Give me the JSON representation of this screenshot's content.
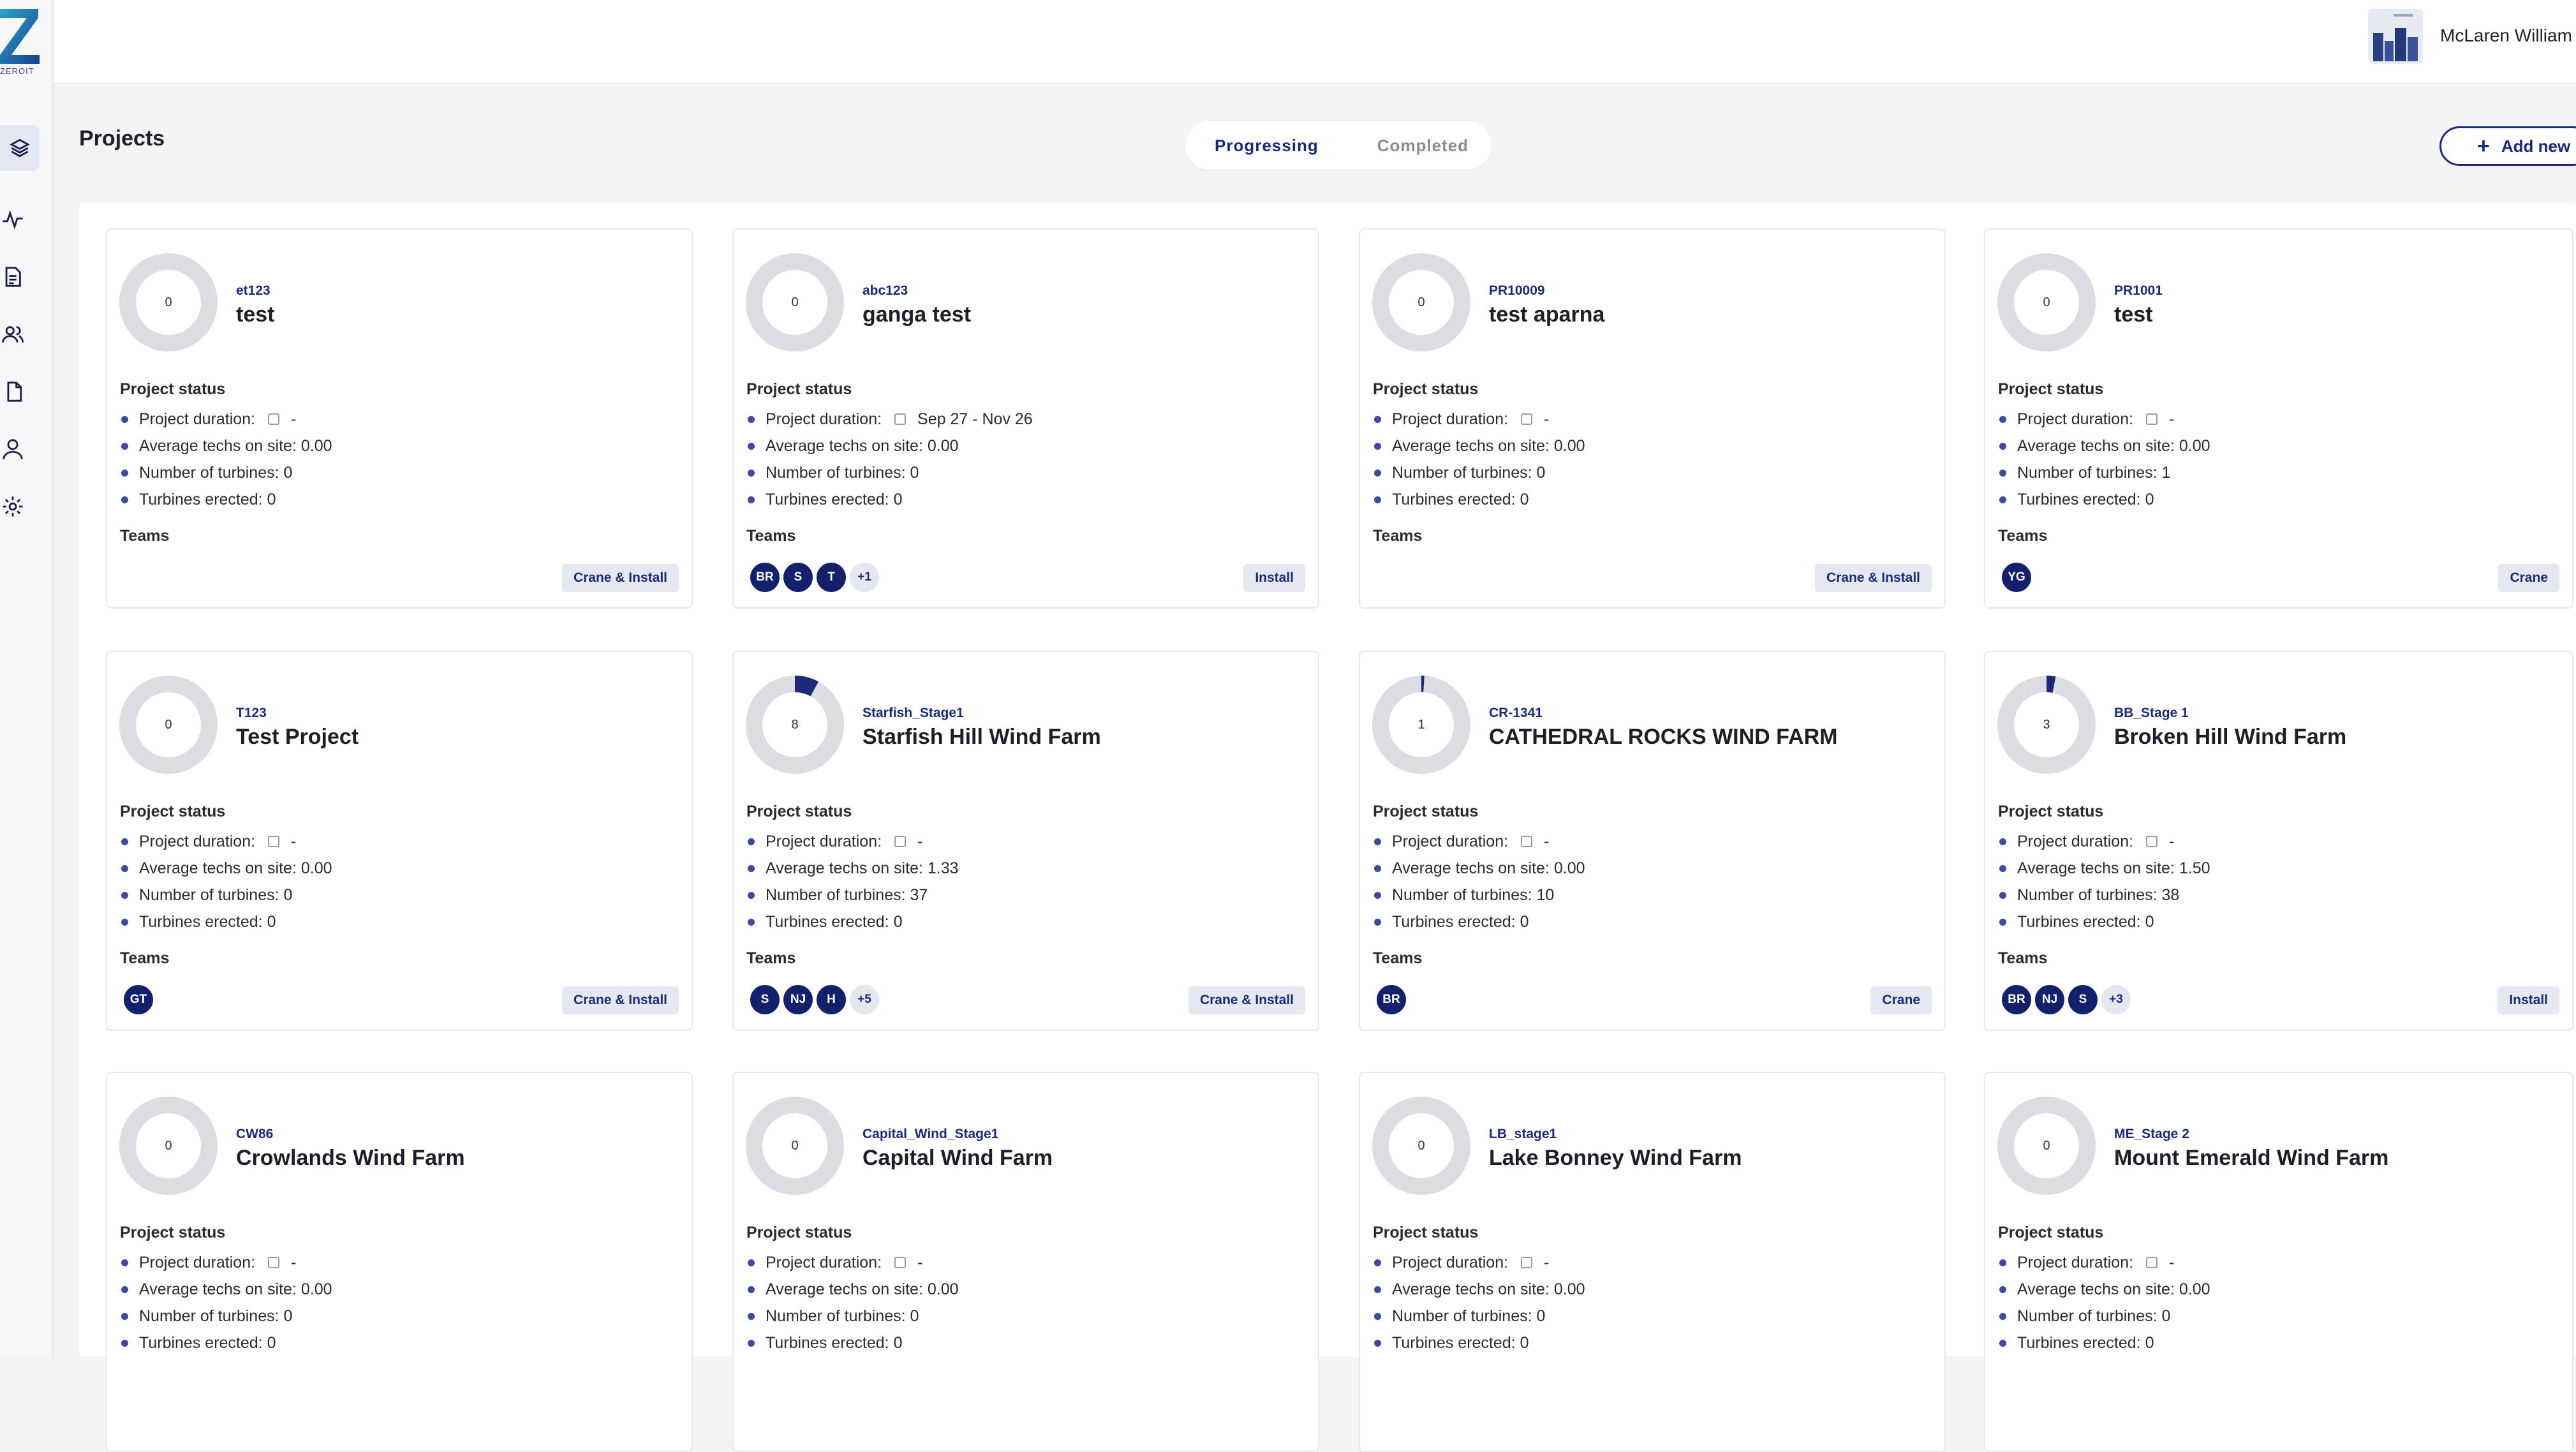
{
  "brand": {
    "logo_text": "ZEROIT"
  },
  "nav": {
    "items": [
      "projects-icon",
      "activity-icon",
      "documents-icon",
      "teams-icon",
      "files-icon",
      "profile-icon",
      "settings-icon"
    ]
  },
  "header": {
    "user_name": "McLaren William"
  },
  "page": {
    "title": "Projects",
    "tabs": [
      "Progressing",
      "Completed"
    ],
    "add_label": "Add new",
    "status_label": "Project status",
    "teams_label": "Teams",
    "duration_label": "Project duration:",
    "avg_label": "Average techs on site:",
    "turbines_label": "Number of turbines:",
    "erected_label": "Turbines erected:"
  },
  "projects": [
    {
      "code": "et123",
      "name": "test",
      "donut": "0",
      "duration": "-",
      "avg": "0.00",
      "turbines": "0",
      "erected": "0",
      "members": [],
      "tag": "Crane & Install"
    },
    {
      "code": "abc123",
      "name": "ganga test",
      "donut": "0",
      "duration": "Sep 27 - Nov 26",
      "avg": "0.00",
      "turbines": "0",
      "erected": "0",
      "members": [
        "BR",
        "S",
        "T",
        "+1"
      ],
      "tag": "Install"
    },
    {
      "code": "PR10009",
      "name": "test aparna",
      "donut": "0",
      "duration": "-",
      "avg": "0.00",
      "turbines": "0",
      "erected": "0",
      "members": [],
      "tag": "Crane & Install"
    },
    {
      "code": "PR1001",
      "name": "test",
      "donut": "0",
      "duration": "-",
      "avg": "0.00",
      "turbines": "1",
      "erected": "0",
      "members": [
        "YG"
      ],
      "tag": "Crane"
    },
    {
      "code": "T123",
      "name": "Test Project",
      "donut": "0",
      "duration": "-",
      "avg": "0.00",
      "turbines": "0",
      "erected": "0",
      "members": [
        "GT"
      ],
      "tag": "Crane & Install"
    },
    {
      "code": "Starfish_Stage1",
      "name": "Starfish Hill Wind Farm",
      "donut": "8",
      "duration": "-",
      "avg": "1.33",
      "turbines": "37",
      "erected": "0",
      "members": [
        "S",
        "NJ",
        "H",
        "+5"
      ],
      "tag": "Crane & Install"
    },
    {
      "code": "CR-1341",
      "name": "CATHEDRAL ROCKS WIND FARM",
      "donut": "1",
      "duration": "-",
      "avg": "0.00",
      "turbines": "10",
      "erected": "0",
      "members": [
        "BR"
      ],
      "tag": "Crane"
    },
    {
      "code": "BB_Stage 1",
      "name": "Broken Hill Wind Farm",
      "donut": "3",
      "duration": "-",
      "avg": "1.50",
      "turbines": "38",
      "erected": "0",
      "members": [
        "BR",
        "NJ",
        "S",
        "+3"
      ],
      "tag": "Install"
    },
    {
      "code": "CW86",
      "name": "Crowlands Wind Farm",
      "donut": "0",
      "duration": "-",
      "avg": "0.00",
      "turbines": "0",
      "erected": "0",
      "members": [],
      "tag": ""
    },
    {
      "code": "Capital_Wind_Stage1",
      "name": "Capital Wind Farm",
      "donut": "0",
      "duration": "-",
      "avg": "0.00",
      "turbines": "0",
      "erected": "0",
      "members": [],
      "tag": ""
    },
    {
      "code": "LB_stage1",
      "name": "Lake Bonney Wind Farm",
      "donut": "0",
      "duration": "-",
      "avg": "0.00",
      "turbines": "0",
      "erected": "0",
      "members": [],
      "tag": ""
    },
    {
      "code": "ME_Stage 2",
      "name": "Mount Emerald Wind Farm",
      "donut": "0",
      "duration": "-",
      "avg": "0.00",
      "turbines": "0",
      "erected": "0",
      "members": [],
      "tag": ""
    }
  ],
  "colors": {
    "accent": "#1c2a7a",
    "member_bg": "#13206b",
    "donut_track": "#dcdde2"
  }
}
